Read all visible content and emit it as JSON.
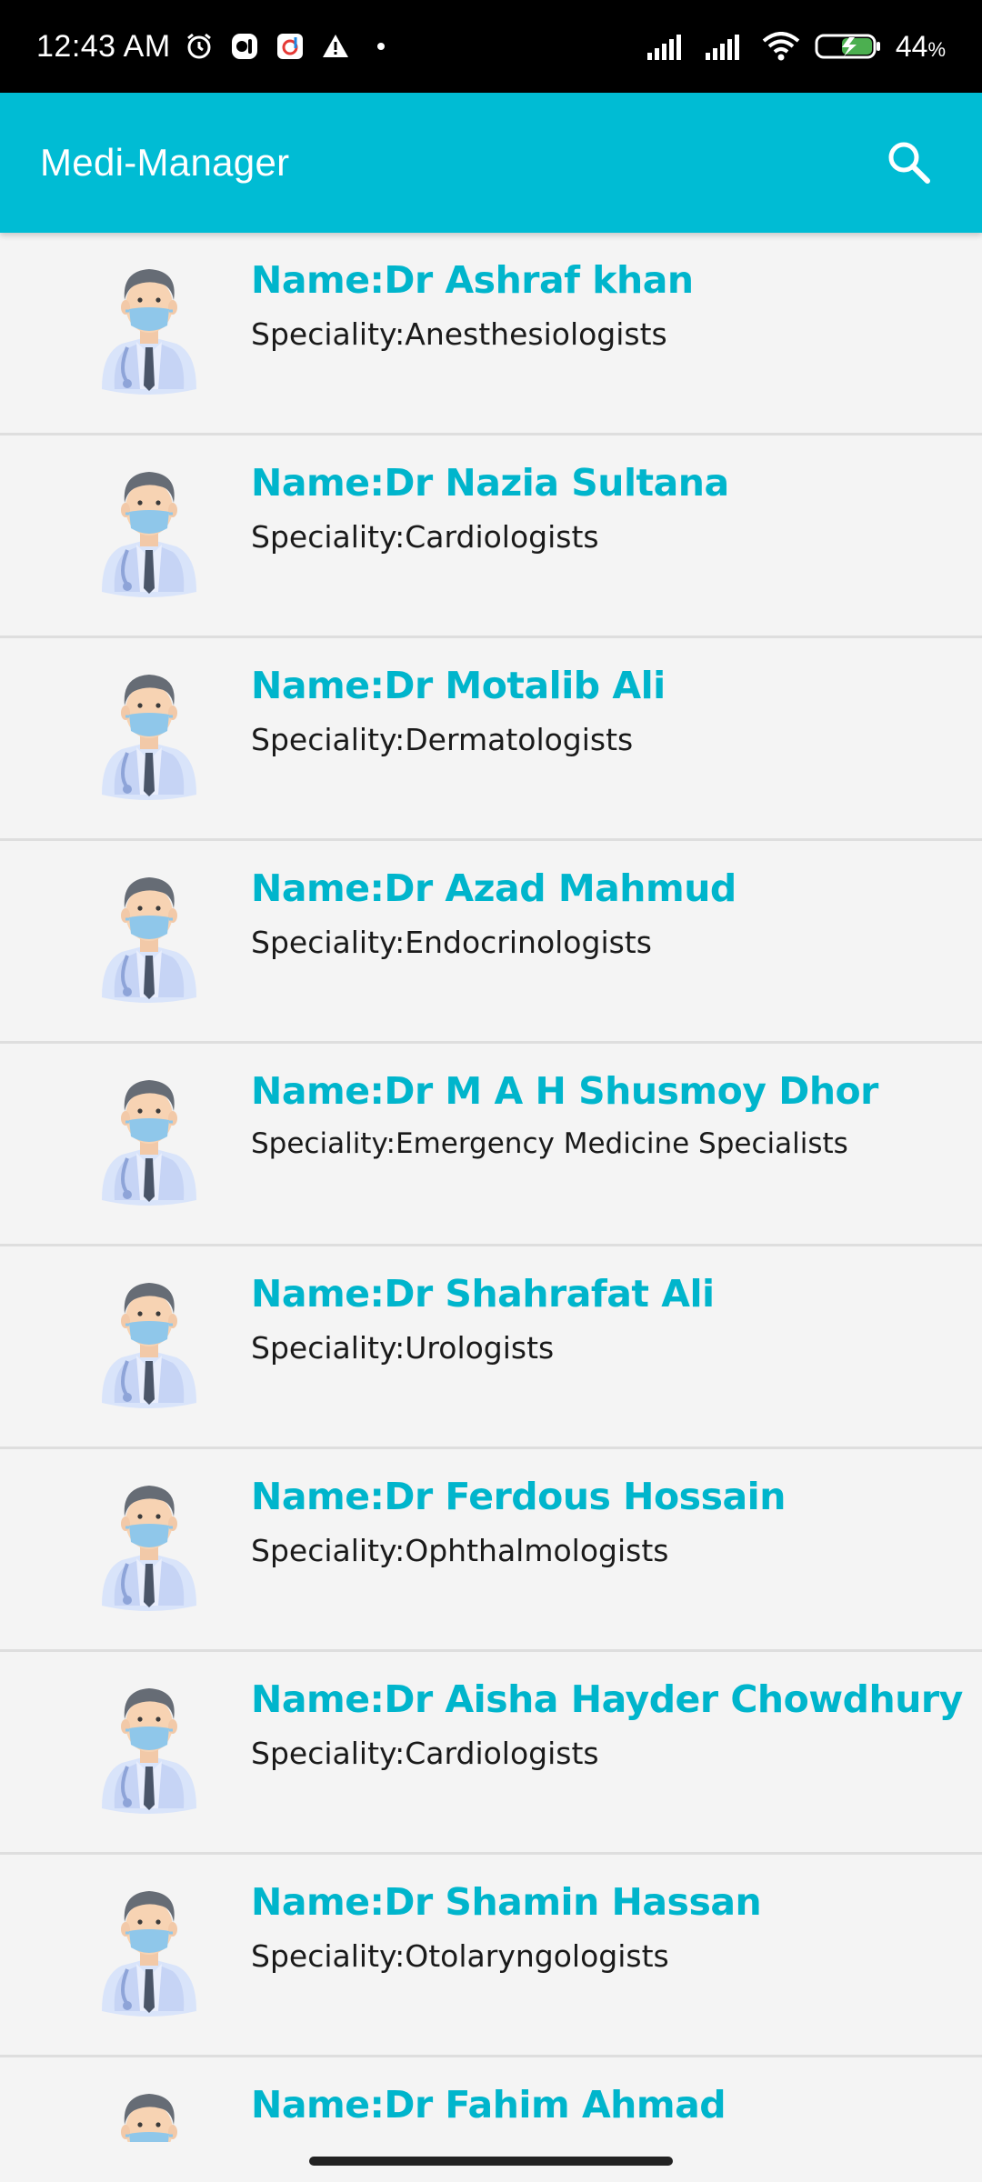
{
  "status_bar": {
    "time": "12:43 AM",
    "battery": "44",
    "battery_unit": "%",
    "icons_left": [
      "alarm-icon",
      "app-icon",
      "app-icon",
      "warning-icon",
      "dot-icon"
    ],
    "icons_right": [
      "signal-icon",
      "signal-icon",
      "wifi-icon",
      "battery-charging-icon"
    ]
  },
  "app_bar": {
    "title": "Medi-Manager",
    "search_icon": "search-icon",
    "background_color": "#00bcd4"
  },
  "theme": {
    "accent": "#00b5cc",
    "text": "#1a1a1a",
    "background": "#f4f4f4"
  },
  "doctors": [
    {
      "name": "Name:Dr Ashraf khan",
      "speciality": "Speciality:Anesthesiologists"
    },
    {
      "name": "Name:Dr Nazia Sultana",
      "speciality": "Speciality:Cardiologists"
    },
    {
      "name": "Name:Dr Motalib Ali",
      "speciality": "Speciality:Dermatologists"
    },
    {
      "name": "Name:Dr Azad Mahmud",
      "speciality": "Speciality:Endocrinologists"
    },
    {
      "name": "Name:Dr M A H Shusmoy Dhor",
      "speciality": "Speciality:Emergency Medicine Specialists"
    },
    {
      "name": "Name:Dr Shahrafat Ali",
      "speciality": "Speciality:Urologists"
    },
    {
      "name": "Name:Dr Ferdous Hossain",
      "speciality": "Speciality:Ophthalmologists"
    },
    {
      "name": "Name:Dr Aisha Hayder Chowdhury",
      "speciality": "Speciality:Cardiologists"
    },
    {
      "name": "Name:Dr Shamin Hassan",
      "speciality": "Speciality:Otolaryngologists"
    },
    {
      "name": "Name:Dr Fahim Ahmad",
      "speciality": ""
    }
  ]
}
